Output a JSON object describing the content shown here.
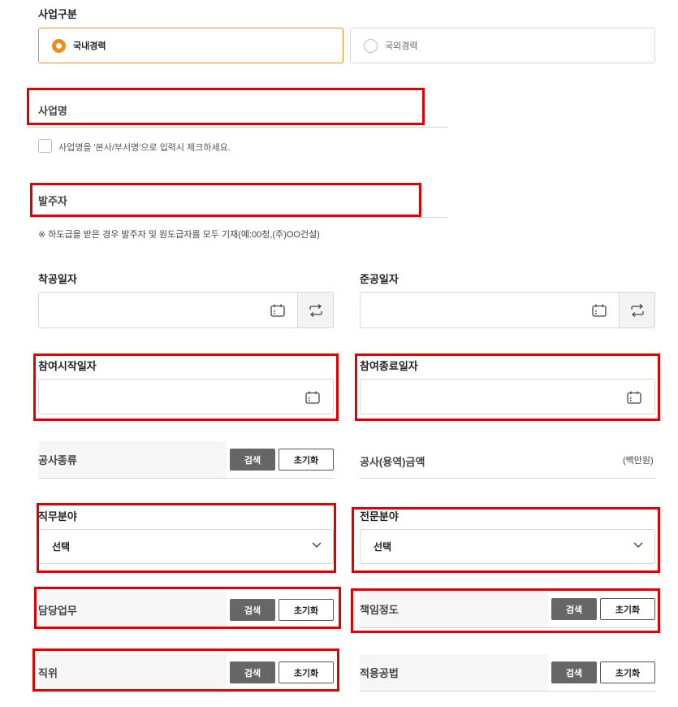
{
  "business_type": {
    "label": "사업구분",
    "options": [
      {
        "label": "국내경력",
        "selected": true
      },
      {
        "label": "국외경력",
        "selected": false
      }
    ]
  },
  "project_name": {
    "label": "사업명",
    "checkbox_label": "사업명을 '본사/부서명'으로 입력시 체크하세요."
  },
  "client": {
    "label": "발주자",
    "note": "※ 하도급을 받은 경우 발주자 및 원도급자를 모두 기재(예:00청,(주)OO건설)"
  },
  "dates": {
    "start_label": "착공일자",
    "end_label": "준공일자",
    "participation_start_label": "참여시작일자",
    "participation_end_label": "참여종료일자"
  },
  "construction_type": {
    "label": "공사종류",
    "search": "검색",
    "reset": "초기화"
  },
  "amount": {
    "label": "공사(용역)금액",
    "unit": "(백만원)"
  },
  "job_field": {
    "label": "직무분야",
    "value": "선택"
  },
  "specialty_field": {
    "label": "전문분야",
    "value": "선택"
  },
  "duty": {
    "label": "담당업무",
    "search": "검색",
    "reset": "초기화"
  },
  "responsibility": {
    "label": "책임정도",
    "search": "검색",
    "reset": "초기화"
  },
  "position": {
    "label": "직위",
    "search": "검색",
    "reset": "초기화"
  },
  "method": {
    "label": "적용공법",
    "search": "검색",
    "reset": "초기화"
  },
  "colors": {
    "accent": "#f08c1e",
    "highlight": "#e00000",
    "button_dark": "#666666"
  }
}
